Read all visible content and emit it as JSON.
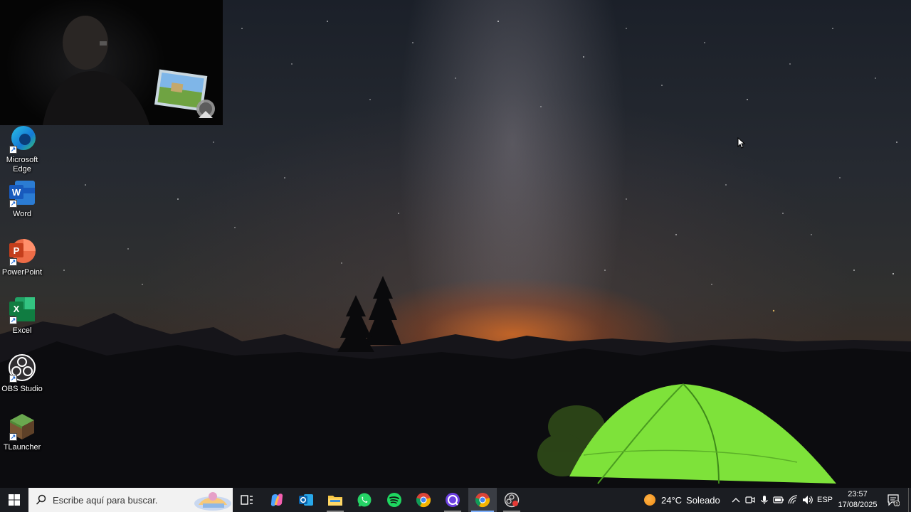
{
  "desktop": {
    "icons": [
      {
        "label": "Microsoft\nEdge",
        "icon": "edge-icon"
      },
      {
        "label": "Word",
        "icon": "word-icon"
      },
      {
        "label": "PowerPoint",
        "icon": "powerpoint-icon"
      },
      {
        "label": "Excel",
        "icon": "excel-icon"
      },
      {
        "label": "OBS Studio",
        "icon": "obs-icon"
      },
      {
        "label": "TLauncher",
        "icon": "tlauncher-icon"
      }
    ],
    "wallpaper": "night-sky-tent"
  },
  "taskbar": {
    "search_placeholder": "Escribe aquí para buscar.",
    "apps": [
      {
        "name": "task-view",
        "icon": "task-view-icon"
      },
      {
        "name": "copilot",
        "icon": "copilot-icon"
      },
      {
        "name": "outlook",
        "icon": "outlook-icon"
      },
      {
        "name": "file-explorer",
        "icon": "folder-icon"
      },
      {
        "name": "whatsapp",
        "icon": "whatsapp-icon"
      },
      {
        "name": "spotify",
        "icon": "spotify-icon"
      },
      {
        "name": "chrome",
        "icon": "chrome-icon"
      },
      {
        "name": "app-circle",
        "icon": "circle-app-icon"
      },
      {
        "name": "chrome-profile",
        "icon": "chrome-icon"
      },
      {
        "name": "obs-record",
        "icon": "obs-icon"
      }
    ],
    "weather": {
      "temp": "24°C",
      "condition": "Soleado"
    },
    "language": "ESP",
    "time": "23:57",
    "date": "17/08/2025",
    "notification_count": "1"
  },
  "colors": {
    "taskbar_bg": "#1b1d22",
    "accent": "#7fb2ff",
    "tent_green": "#7ee23a"
  }
}
